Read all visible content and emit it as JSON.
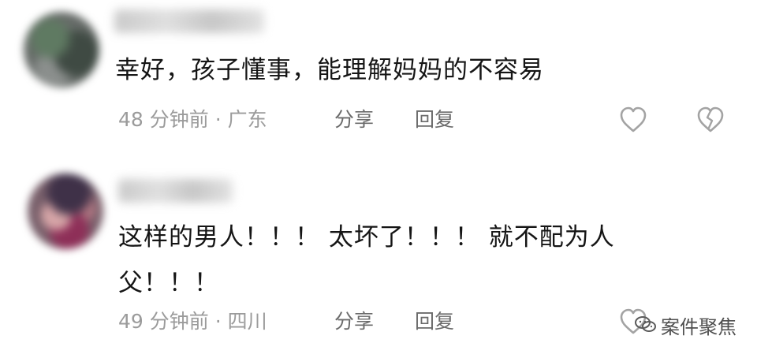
{
  "comments": [
    {
      "text": "幸好，孩子懂事，能理解妈妈的不容易",
      "time_location": "48 分钟前 · 广东",
      "share_label": "分享",
      "reply_label": "回复",
      "like_icon": "heart-outline-icon",
      "dislike_icon": "broken-heart-outline-icon"
    },
    {
      "text": "这样的男人！！！ 太坏了！！！ 就不配为人父！！！",
      "time_location": "49 分钟前 · 四川",
      "share_label": "分享",
      "reply_label": "回复",
      "like_icon": "heart-outline-icon",
      "dislike_icon": "broken-heart-outline-icon"
    }
  ],
  "watermark": {
    "text": "案件聚焦",
    "icon": "wechat-like-logo-icon"
  },
  "colors": {
    "text": "#151515",
    "meta": "#9b9b9b",
    "action": "#6b6b6b",
    "icon": "#a3a3a3"
  }
}
